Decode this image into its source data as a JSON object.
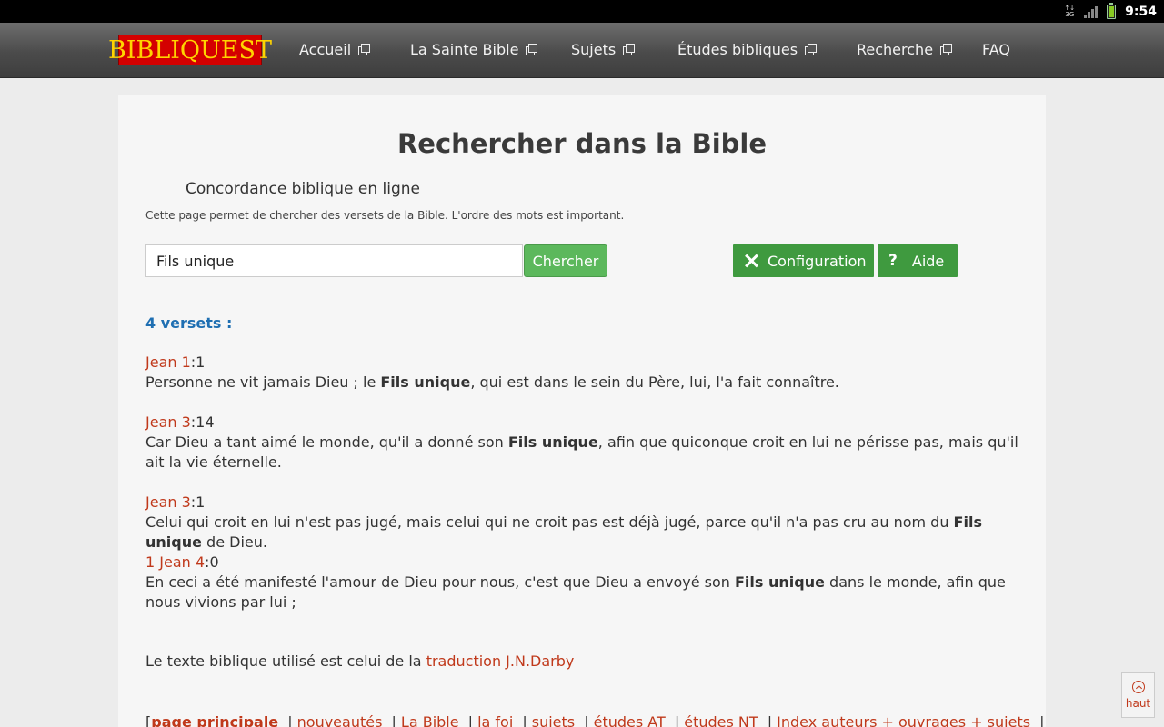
{
  "status_bar": {
    "network": "3G",
    "time": "9:54",
    "icons": [
      "network-3g-icon",
      "signal-icon",
      "battery-icon"
    ]
  },
  "nav": {
    "logo": "BIBLIQUEST",
    "items": [
      {
        "label": "Accueil",
        "external": true
      },
      {
        "label": "La Sainte Bible",
        "external": true
      },
      {
        "label": "Sujets",
        "external": true
      },
      {
        "label": "Études bibliques",
        "external": true
      },
      {
        "label": "Recherche",
        "external": true
      },
      {
        "label": "FAQ",
        "external": false
      }
    ]
  },
  "page": {
    "title": "Rechercher dans la Bible",
    "subtitle": "Concordance biblique en ligne",
    "intro": "Cette page permet de chercher des versets de la Bible. L'ordre des mots est important."
  },
  "search": {
    "value": "Fils unique",
    "button_label": "Chercher",
    "config_label": "Configuration",
    "help_label": "Aide"
  },
  "results": {
    "count_label": "4 versets :",
    "verses": [
      {
        "ref": "Jean 1",
        "suffix": ":1",
        "before": "Personne ne vit jamais Dieu ; le ",
        "highlight": "Fils unique",
        "after": ", qui est dans le sein du Père, lui, l'a fait connaître."
      },
      {
        "ref": "Jean 3",
        "suffix": ":14",
        "before": "Car Dieu a tant aimé le monde, qu'il a donné son ",
        "highlight": "Fils unique",
        "after": ", afin que quiconque croit en lui ne périsse pas, mais qu'il ait la vie éternelle."
      },
      {
        "ref": "Jean 3",
        "suffix": ":1",
        "before": "Celui qui croit en lui n'est pas jugé, mais celui qui ne croit pas est déjà jugé, parce qu'il n'a pas cru au nom du ",
        "highlight": "Fils unique",
        "after": " de Dieu."
      },
      {
        "ref": "1 Jean 4",
        "suffix": ":0",
        "before": "En ceci a été manifesté l'amour de Dieu pour nous, c'est que Dieu a envoyé son ",
        "highlight": "Fils unique",
        "after": " dans le monde, afin que nous vivions par lui ;"
      }
    ]
  },
  "footer": {
    "note_prefix": "Le texte biblique utilisé est celui de la ",
    "note_link": "traduction J.N.Darby",
    "bracket": "[",
    "links": [
      "page principale",
      "nouveautés",
      "La Bible",
      "la foi",
      "sujets",
      "études AT",
      "études NT",
      "Index auteurs + ouvrages + sujets"
    ],
    "separator": "|"
  },
  "back_to_top": {
    "label": "haut"
  },
  "colors": {
    "link": "#c0391b",
    "count": "#1f6fb2",
    "button_green": "#5cb85c",
    "button_dark_green": "#3f9a3f",
    "logo_red": "#d40000",
    "logo_yellow": "#ffd400"
  }
}
